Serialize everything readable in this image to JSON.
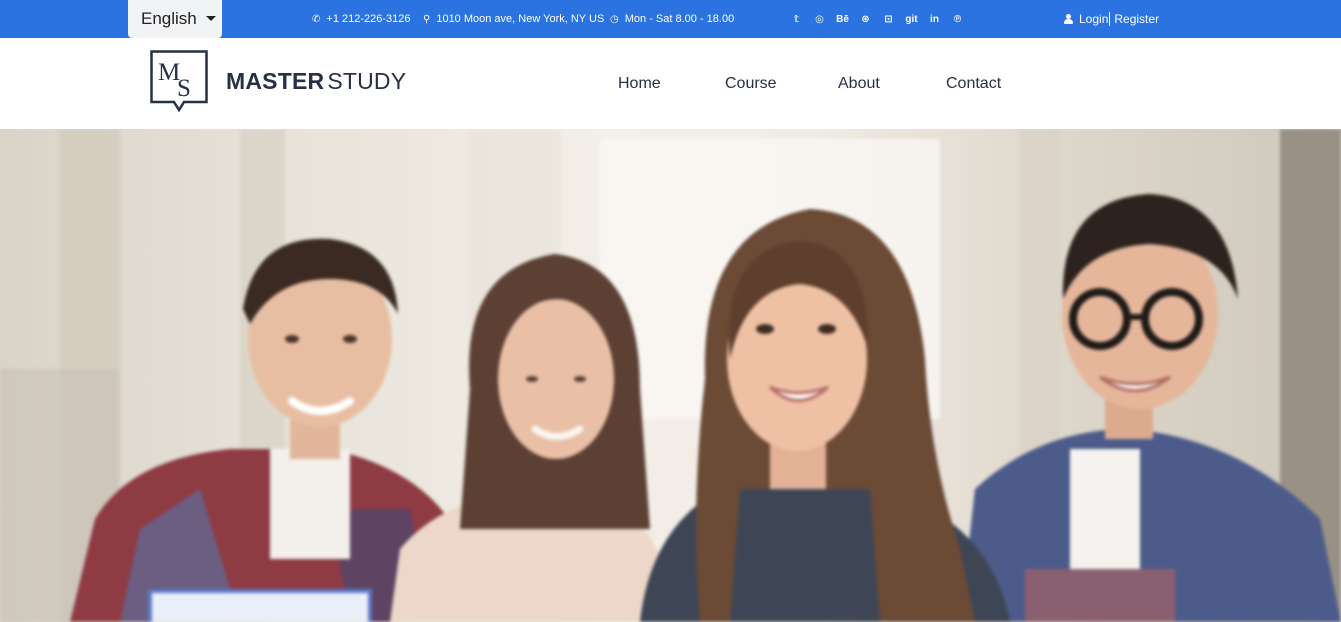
{
  "topbar": {
    "language": "English",
    "phone": "+1 212-226-3126",
    "address": "1010 Moon ave, New York, NY US",
    "hours": "Mon - Sat 8.00 - 18.00",
    "social_icons": [
      "twitter-icon",
      "instagram-icon",
      "behance-icon",
      "dribbble-icon",
      "flickr-icon",
      "git-icon",
      "linkedin-icon",
      "pinterest-icon"
    ],
    "social_glyphs": {
      "twitter": "𝕥",
      "instagram": "◎",
      "behance": "Bē",
      "dribbble": "⊛",
      "flickr": "⊡",
      "git": "git",
      "linkedin": "in",
      "pinterest": "℗"
    },
    "login": "Login",
    "register": "Register",
    "background_color": "#2b73e0"
  },
  "header": {
    "logo_mark": "MS",
    "brand_bold": "MASTER",
    "brand_light": "STUDY",
    "nav": [
      "Home",
      "Course",
      "About",
      "Contact"
    ]
  }
}
